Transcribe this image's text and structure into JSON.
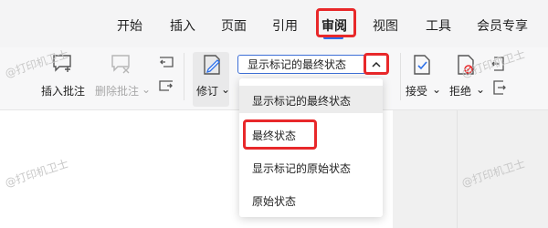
{
  "tabs": [
    {
      "label": "开始"
    },
    {
      "label": "插入"
    },
    {
      "label": "页面"
    },
    {
      "label": "引用"
    },
    {
      "label": "审阅"
    },
    {
      "label": "视图"
    },
    {
      "label": "工具"
    },
    {
      "label": "会员专享"
    }
  ],
  "active_tab": "审阅",
  "ribbon": {
    "insert_comment": "插入批注",
    "delete_comment": "删除批注",
    "revise": "修订",
    "accept": "接受",
    "reject": "拒绝"
  },
  "display_mode": {
    "selected": "显示标记的最终状态",
    "options": [
      {
        "label": "显示标记的最终状态"
      },
      {
        "label": "最终状态"
      },
      {
        "label": "显示标记的原始状态"
      },
      {
        "label": "原始状态"
      }
    ]
  },
  "watermark": "@打印机卫士",
  "colors": {
    "highlight": "#e8282a",
    "accent": "#2c6fe8"
  }
}
